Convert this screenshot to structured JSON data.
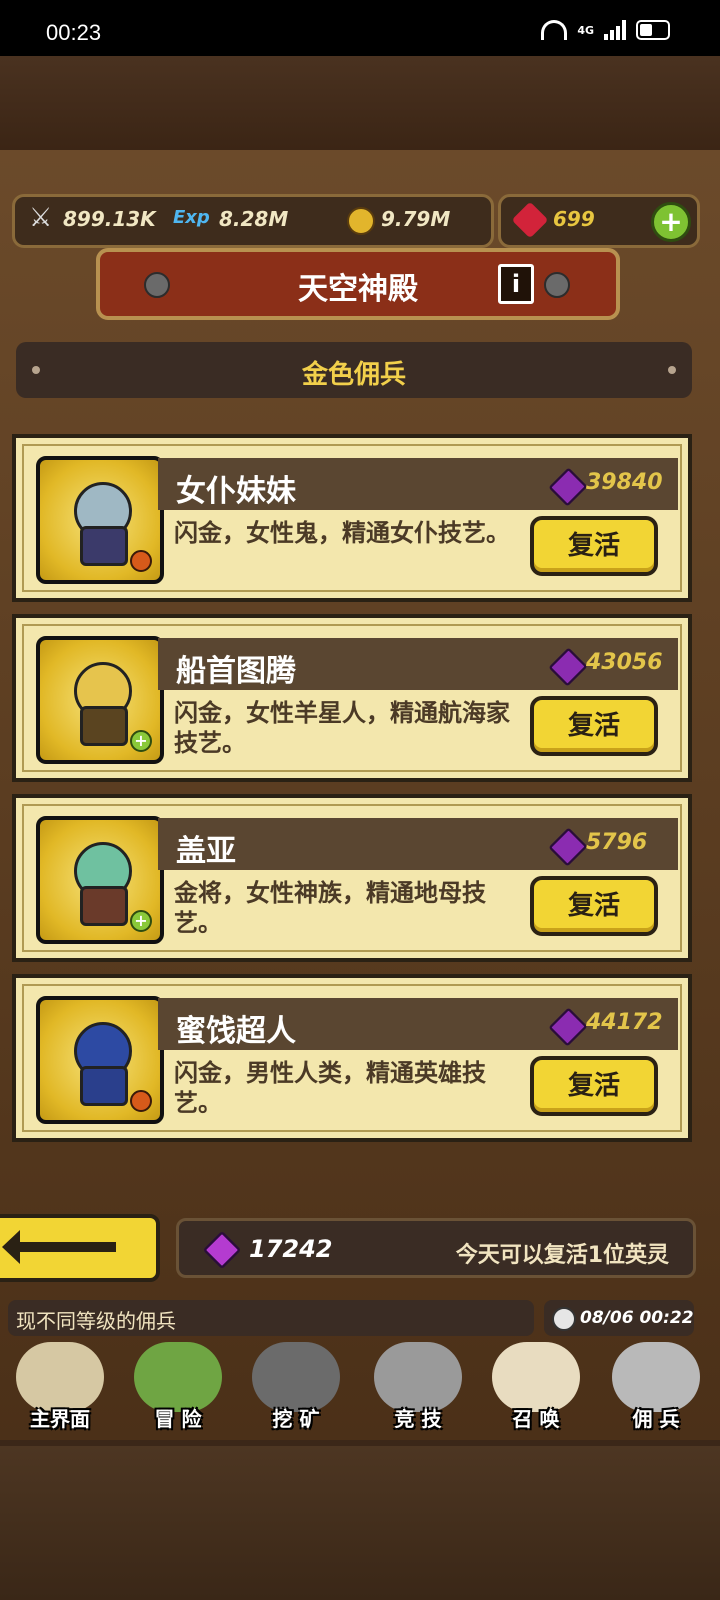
{
  "status": {
    "time": "00:23",
    "network": "4G"
  },
  "resources": {
    "attack": "899.13K",
    "exp": "8.28M",
    "gold": "9.79M",
    "ruby": "699"
  },
  "title": "天空神殿",
  "section": "金色佣兵",
  "heroes": [
    {
      "name": "女仆妹妹",
      "price": "39840",
      "desc": "闪金，女性鬼，精通女仆技艺。",
      "button": "复活",
      "head_color": "#9fb8c4",
      "body_color": "#3b3a6a",
      "badge": "orange"
    },
    {
      "name": "船首图腾",
      "price": "43056",
      "desc": "闪金，女性羊星人，精通航海家技艺。",
      "button": "复活",
      "head_color": "#e6c44d",
      "body_color": "#5a4420",
      "badge": "green"
    },
    {
      "name": "盖亚",
      "price": "5796",
      "desc": "金将，女性神族，精通地母技艺。",
      "button": "复活",
      "head_color": "#6fc1a0",
      "body_color": "#6a3a2a",
      "badge": "green"
    },
    {
      "name": "蜜饯超人",
      "price": "44172",
      "desc": "闪金，男性人类，精通英雄技艺。",
      "button": "复活",
      "head_color": "#2d4aa3",
      "body_color": "#2a3f8c",
      "badge": "orange"
    }
  ],
  "footer": {
    "gem_count": "17242",
    "note": "今天可以复活1位英灵"
  },
  "ticker": "现不同等级的佣兵",
  "clock": "08/06 00:22",
  "nav": [
    "主界面",
    "冒 险",
    "挖 矿",
    "竞 技",
    "召 唤",
    "佣 兵"
  ]
}
